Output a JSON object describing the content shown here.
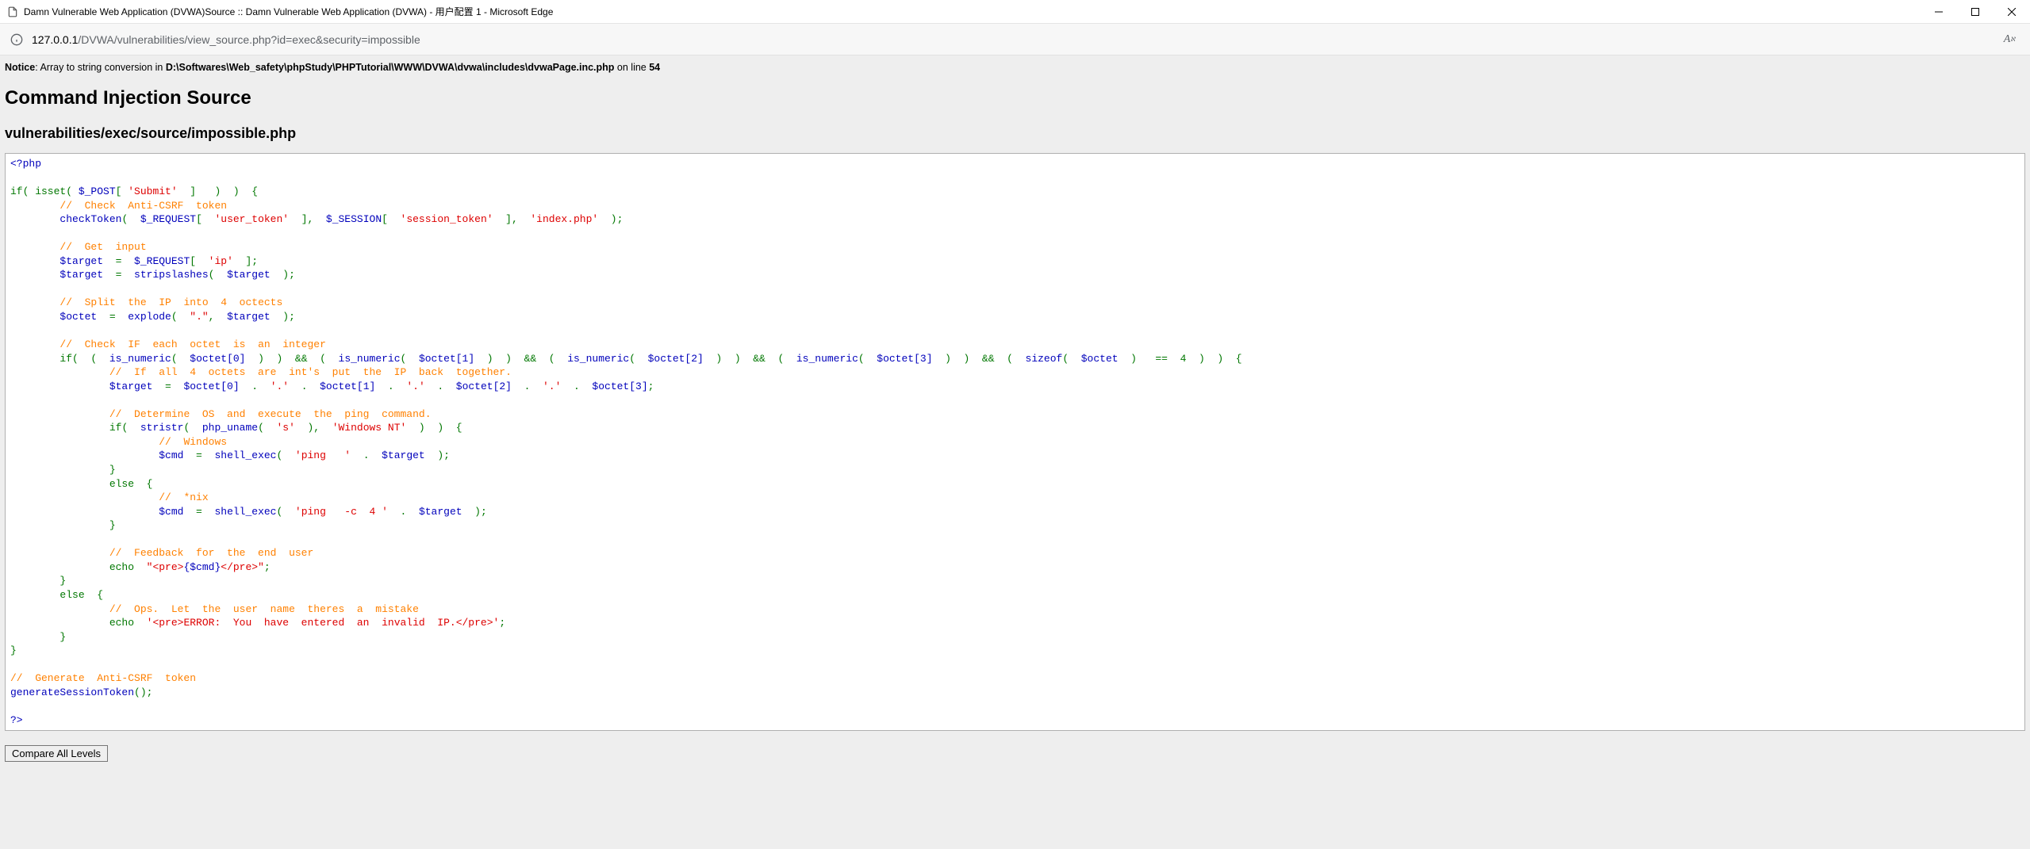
{
  "window": {
    "title": "Damn Vulnerable Web Application (DVWA)Source :: Damn Vulnerable Web Application (DVWA) - 用户配置 1 - Microsoft Edge"
  },
  "address": {
    "host": "127.0.0.1",
    "path": "/DVWA/vulnerabilities/view_source.php?id=exec&security=impossible",
    "reader_label": "A"
  },
  "notice": {
    "prefix_bold": "Notice",
    "middle": ": Array to string conversion in ",
    "path_bold": "D:\\Softwares\\Web_safety\\phpStudy\\PHPTutorial\\WWW\\DVWA\\dvwa\\includes\\dvwaPage.inc.php",
    "suffix_plain": " on line ",
    "line_bold": "54"
  },
  "headings": {
    "h1": "Command Injection Source",
    "h2": "vulnerabilities/exec/source/impossible.php"
  },
  "code": {
    "open_tag": "<?php",
    "l_if_isset_1": "if( isset( ",
    "l_if_isset_var": "$_POST",
    "l_if_isset_2": "[ ",
    "l_if_isset_str": "'Submit'",
    "l_if_isset_3": "  ]   )  )  {",
    "c_anticsrf": "//  Check  Anti-CSRF  token",
    "checkToken_fn": "checkToken",
    "checkToken_open": "(  ",
    "req_var": "$_REQUEST",
    "req_brk_open": "[  ",
    "str_user_token": "'user_token'",
    "brk_close_comma": "  ],  ",
    "sess_var": "$_SESSION",
    "str_session_token": "'session_token'",
    "checkToken_end": "  ],  ",
    "str_index": "'index.php'",
    "checkToken_close": "  );",
    "c_getinput": "//  Get  input",
    "target_var": "$target",
    "eq": "  =  ",
    "str_ip": "'ip'",
    "brk_close_semi": "  ];",
    "stripslashes_fn": "stripslashes",
    "open_paren": "(  ",
    "close_paren_semi": "  );",
    "c_split": "//  Split  the  IP  into  4  octects",
    "octet_var": "$octet",
    "explode_fn": "explode",
    "str_dot": "\".\"",
    "comma_sp": ",  ",
    "c_checkint": "//  Check  IF  each  octet  is  an  integer",
    "if_kw": "if",
    "open2": "(  (  ",
    "isnum_fn": "is_numeric",
    "oct0": "$octet[0]",
    "close2_amp": "  )  )  &&  (  ",
    "oct1": "$octet[1]",
    "oct2": "$octet[2]",
    "oct3": "$octet[3]",
    "close2_amp_sizeof": "  )  )  &&  (  ",
    "sizeof_fn": "sizeof",
    "close_eq4": "  )   ==  4  )  )  {",
    "c_all4": "//  If  all  4  octets  are  int's  put  the  IP  back  together.",
    "dot_concat": "  .  ",
    "str_dot2": "'.'",
    "semi": ";",
    "c_determine": "//  Determine  OS  and  execute  the  ping  command.",
    "stristr_fn": "stristr",
    "phpuname_fn": "php_uname",
    "str_s": "'s'",
    "close_comma": "  ),  ",
    "str_winnt": "'Windows NT'",
    "close3_brace": "  )  )  {",
    "c_windows": "//  Windows",
    "cmd_var": "$cmd",
    "shellexec_fn": "shell_exec",
    "str_ping_sp": "'ping   '",
    "close_brace": "}",
    "else_kw": "else  {",
    "c_nix": "//  *nix",
    "str_ping_c4": "'ping   -c  4 '",
    "c_feedback": "//  Feedback  for  the  end  user",
    "echo_kw": "echo  ",
    "str_pre_open": "\"<pre>",
    "cmd_interp": "{$cmd}",
    "str_pre_close": "</pre>\"",
    "c_ops": "//  Ops.  Let  the  user  name  theres  a  mistake",
    "str_error": "'<pre>ERROR:  You  have  entered  an  invalid  IP.</pre>'",
    "c_generate": "//  Generate  Anti-CSRF  token",
    "gensess_fn": "generateSessionToken",
    "gensess_call": "();",
    "close_tag": "?>"
  },
  "compare_btn": "Compare All Levels"
}
